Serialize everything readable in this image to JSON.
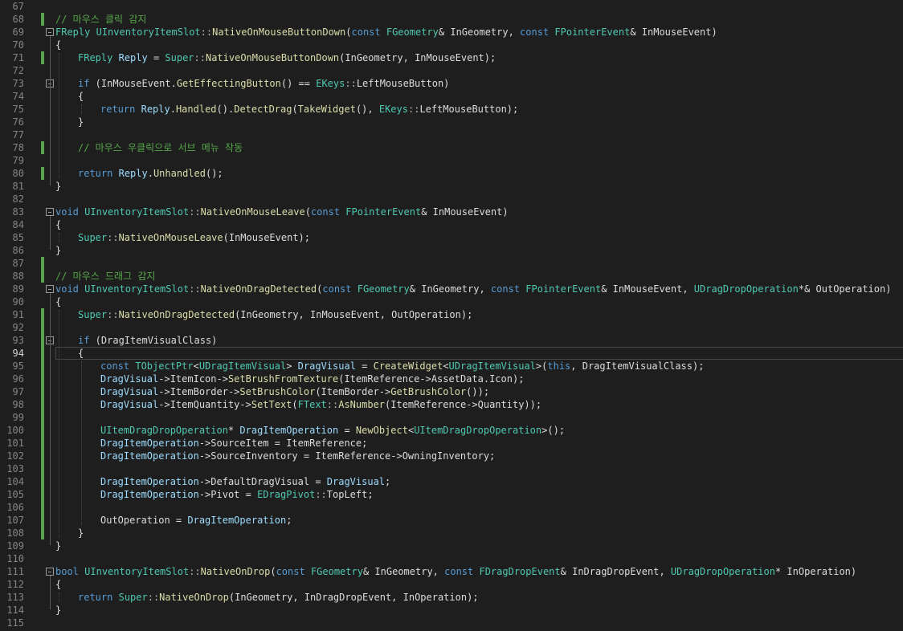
{
  "editor": {
    "first_line": 67,
    "current_line": 94,
    "lines": [
      {
        "n": "67",
        "i": 0,
        "t": []
      },
      {
        "n": "68",
        "i": 0,
        "chg": true,
        "t": [
          [
            "cm",
            "// 마우스 클릭 감지"
          ]
        ]
      },
      {
        "n": "69",
        "i": 0,
        "fold": true,
        "t": [
          [
            "ty",
            "FReply"
          ],
          [
            "pl",
            " "
          ],
          [
            "ty",
            "UInventoryItemSlot"
          ],
          [
            "op",
            "::"
          ],
          [
            "fn",
            "NativeOnMouseButtonDown"
          ],
          [
            "pl",
            "("
          ],
          [
            "kw",
            "const"
          ],
          [
            "pl",
            " "
          ],
          [
            "ty",
            "FGeometry"
          ],
          [
            "pl",
            "& InGeometry, "
          ],
          [
            "kw",
            "const"
          ],
          [
            "pl",
            " "
          ],
          [
            "ty",
            "FPointerEvent"
          ],
          [
            "pl",
            "& InMouseEvent)"
          ]
        ]
      },
      {
        "n": "70",
        "i": 0,
        "t": [
          [
            "pl",
            "{"
          ]
        ]
      },
      {
        "n": "71",
        "i": 1,
        "chg": true,
        "t": [
          [
            "ty",
            "FReply"
          ],
          [
            "pl",
            " "
          ],
          [
            "var",
            "Reply"
          ],
          [
            "pl",
            " = "
          ],
          [
            "ty",
            "Super"
          ],
          [
            "op",
            "::"
          ],
          [
            "fn",
            "NativeOnMouseButtonDown"
          ],
          [
            "pl",
            "(InGeometry, InMouseEvent);"
          ]
        ]
      },
      {
        "n": "72",
        "i": 1,
        "t": []
      },
      {
        "n": "73",
        "i": 1,
        "fold": true,
        "t": [
          [
            "kw",
            "if"
          ],
          [
            "pl",
            " (InMouseEvent."
          ],
          [
            "fn",
            "GetEffectingButton"
          ],
          [
            "pl",
            "() == "
          ],
          [
            "ty",
            "EKeys"
          ],
          [
            "op",
            "::"
          ],
          [
            "pl",
            "LeftMouseButton)"
          ]
        ]
      },
      {
        "n": "74",
        "i": 1,
        "t": [
          [
            "pl",
            "{"
          ]
        ]
      },
      {
        "n": "75",
        "i": 2,
        "t": [
          [
            "kw",
            "return"
          ],
          [
            "pl",
            " "
          ],
          [
            "var",
            "Reply"
          ],
          [
            "pl",
            "."
          ],
          [
            "fn",
            "Handled"
          ],
          [
            "pl",
            "()."
          ],
          [
            "fn",
            "DetectDrag"
          ],
          [
            "pl",
            "("
          ],
          [
            "fn",
            "TakeWidget"
          ],
          [
            "pl",
            "(), "
          ],
          [
            "ty",
            "EKeys"
          ],
          [
            "op",
            "::"
          ],
          [
            "pl",
            "LeftMouseButton);"
          ]
        ]
      },
      {
        "n": "76",
        "i": 1,
        "t": [
          [
            "pl",
            "}"
          ]
        ]
      },
      {
        "n": "77",
        "i": 1,
        "t": []
      },
      {
        "n": "78",
        "i": 1,
        "chg": true,
        "t": [
          [
            "cm",
            "// 마우스 우클릭으로 서브 메뉴 작동"
          ]
        ]
      },
      {
        "n": "79",
        "i": 1,
        "t": []
      },
      {
        "n": "80",
        "i": 1,
        "chg": true,
        "t": [
          [
            "kw",
            "return"
          ],
          [
            "pl",
            " "
          ],
          [
            "var",
            "Reply"
          ],
          [
            "pl",
            "."
          ],
          [
            "fn",
            "Unhandled"
          ],
          [
            "pl",
            "();"
          ]
        ]
      },
      {
        "n": "81",
        "i": 0,
        "t": [
          [
            "pl",
            "}"
          ]
        ]
      },
      {
        "n": "82",
        "i": 0,
        "t": []
      },
      {
        "n": "83",
        "i": 0,
        "fold": true,
        "t": [
          [
            "kw",
            "void"
          ],
          [
            "pl",
            " "
          ],
          [
            "ty",
            "UInventoryItemSlot"
          ],
          [
            "op",
            "::"
          ],
          [
            "fn",
            "NativeOnMouseLeave"
          ],
          [
            "pl",
            "("
          ],
          [
            "kw",
            "const"
          ],
          [
            "pl",
            " "
          ],
          [
            "ty",
            "FPointerEvent"
          ],
          [
            "pl",
            "& InMouseEvent)"
          ]
        ]
      },
      {
        "n": "84",
        "i": 0,
        "t": [
          [
            "pl",
            "{"
          ]
        ]
      },
      {
        "n": "85",
        "i": 1,
        "t": [
          [
            "ty",
            "Super"
          ],
          [
            "op",
            "::"
          ],
          [
            "fn",
            "NativeOnMouseLeave"
          ],
          [
            "pl",
            "(InMouseEvent);"
          ]
        ]
      },
      {
        "n": "86",
        "i": 0,
        "t": [
          [
            "pl",
            "}"
          ]
        ]
      },
      {
        "n": "87",
        "i": 0,
        "chg": true,
        "t": []
      },
      {
        "n": "88",
        "i": 0,
        "chg": true,
        "t": [
          [
            "cm",
            "// 마우스 드래그 감지"
          ]
        ]
      },
      {
        "n": "89",
        "i": 0,
        "fold": true,
        "t": [
          [
            "kw",
            "void"
          ],
          [
            "pl",
            " "
          ],
          [
            "ty",
            "UInventoryItemSlot"
          ],
          [
            "op",
            "::"
          ],
          [
            "fn",
            "NativeOnDragDetected"
          ],
          [
            "pl",
            "("
          ],
          [
            "kw",
            "const"
          ],
          [
            "pl",
            " "
          ],
          [
            "ty",
            "FGeometry"
          ],
          [
            "pl",
            "& InGeometry, "
          ],
          [
            "kw",
            "const"
          ],
          [
            "pl",
            " "
          ],
          [
            "ty",
            "FPointerEvent"
          ],
          [
            "pl",
            "& InMouseEvent, "
          ],
          [
            "ty",
            "UDragDropOperation"
          ],
          [
            "pl",
            "*& OutOperation)"
          ]
        ]
      },
      {
        "n": "90",
        "i": 0,
        "t": [
          [
            "pl",
            "{"
          ]
        ]
      },
      {
        "n": "91",
        "i": 1,
        "chg": true,
        "t": [
          [
            "ty",
            "Super"
          ],
          [
            "op",
            "::"
          ],
          [
            "fn",
            "NativeOnDragDetected"
          ],
          [
            "pl",
            "(InGeometry, InMouseEvent, OutOperation);"
          ]
        ]
      },
      {
        "n": "92",
        "i": 1,
        "chg": true,
        "t": []
      },
      {
        "n": "93",
        "i": 1,
        "chg": true,
        "fold": true,
        "t": [
          [
            "kw",
            "if"
          ],
          [
            "pl",
            " (DragItemVisualClass)"
          ]
        ]
      },
      {
        "n": "94",
        "i": 1,
        "chg": true,
        "cur": true,
        "t": [
          [
            "pl",
            "{"
          ]
        ]
      },
      {
        "n": "95",
        "i": 2,
        "chg": true,
        "t": [
          [
            "kw",
            "const"
          ],
          [
            "pl",
            " "
          ],
          [
            "ty",
            "TObjectPtr"
          ],
          [
            "pl",
            "<"
          ],
          [
            "ty",
            "UDragItemVisual"
          ],
          [
            "pl",
            "> "
          ],
          [
            "var",
            "DragVisual"
          ],
          [
            "pl",
            " = "
          ],
          [
            "fn",
            "CreateWidget"
          ],
          [
            "pl",
            "<"
          ],
          [
            "ty",
            "UDragItemVisual"
          ],
          [
            "pl",
            ">("
          ],
          [
            "kw",
            "this"
          ],
          [
            "pl",
            ", DragItemVisualClass);"
          ]
        ]
      },
      {
        "n": "96",
        "i": 2,
        "chg": true,
        "t": [
          [
            "var",
            "DragVisual"
          ],
          [
            "pl",
            "->ItemIcon->"
          ],
          [
            "fn",
            "SetBrushFromTexture"
          ],
          [
            "pl",
            "(ItemReference->AssetData.Icon);"
          ]
        ]
      },
      {
        "n": "97",
        "i": 2,
        "chg": true,
        "t": [
          [
            "var",
            "DragVisual"
          ],
          [
            "pl",
            "->ItemBorder->"
          ],
          [
            "fn",
            "SetBrushColor"
          ],
          [
            "pl",
            "(ItemBorder->"
          ],
          [
            "fn",
            "GetBrushColor"
          ],
          [
            "pl",
            "());"
          ]
        ]
      },
      {
        "n": "98",
        "i": 2,
        "chg": true,
        "t": [
          [
            "var",
            "DragVisual"
          ],
          [
            "pl",
            "->ItemQuantity->"
          ],
          [
            "fn",
            "SetText"
          ],
          [
            "pl",
            "("
          ],
          [
            "ty",
            "FText"
          ],
          [
            "op",
            "::"
          ],
          [
            "fn",
            "AsNumber"
          ],
          [
            "pl",
            "(ItemReference->Quantity));"
          ]
        ]
      },
      {
        "n": "99",
        "i": 2,
        "chg": true,
        "t": []
      },
      {
        "n": "100",
        "i": 2,
        "chg": true,
        "t": [
          [
            "ty",
            "UItemDragDropOperation"
          ],
          [
            "pl",
            "* "
          ],
          [
            "var",
            "DragItemOperation"
          ],
          [
            "pl",
            " = "
          ],
          [
            "fn",
            "NewObject"
          ],
          [
            "pl",
            "<"
          ],
          [
            "ty",
            "UItemDragDropOperation"
          ],
          [
            "pl",
            ">();"
          ]
        ]
      },
      {
        "n": "101",
        "i": 2,
        "chg": true,
        "t": [
          [
            "var",
            "DragItemOperation"
          ],
          [
            "pl",
            "->SourceItem = ItemReference;"
          ]
        ]
      },
      {
        "n": "102",
        "i": 2,
        "chg": true,
        "t": [
          [
            "var",
            "DragItemOperation"
          ],
          [
            "pl",
            "->SourceInventory = ItemReference->OwningInventory;"
          ]
        ]
      },
      {
        "n": "103",
        "i": 2,
        "chg": true,
        "t": []
      },
      {
        "n": "104",
        "i": 2,
        "chg": true,
        "t": [
          [
            "var",
            "DragItemOperation"
          ],
          [
            "pl",
            "->DefaultDragVisual = "
          ],
          [
            "var",
            "DragVisual"
          ],
          [
            "pl",
            ";"
          ]
        ]
      },
      {
        "n": "105",
        "i": 2,
        "chg": true,
        "t": [
          [
            "var",
            "DragItemOperation"
          ],
          [
            "pl",
            "->Pivot = "
          ],
          [
            "ty",
            "EDragPivot"
          ],
          [
            "op",
            "::"
          ],
          [
            "pl",
            "TopLeft;"
          ]
        ]
      },
      {
        "n": "106",
        "i": 2,
        "chg": true,
        "t": []
      },
      {
        "n": "107",
        "i": 2,
        "chg": true,
        "t": [
          [
            "pl",
            "OutOperation = "
          ],
          [
            "var",
            "DragItemOperation"
          ],
          [
            "pl",
            ";"
          ]
        ]
      },
      {
        "n": "108",
        "i": 1,
        "chg": true,
        "t": [
          [
            "pl",
            "}"
          ]
        ]
      },
      {
        "n": "109",
        "i": 0,
        "t": [
          [
            "pl",
            "}"
          ]
        ]
      },
      {
        "n": "110",
        "i": 0,
        "t": []
      },
      {
        "n": "111",
        "i": 0,
        "fold": true,
        "t": [
          [
            "kw",
            "bool"
          ],
          [
            "pl",
            " "
          ],
          [
            "ty",
            "UInventoryItemSlot"
          ],
          [
            "op",
            "::"
          ],
          [
            "fn",
            "NativeOnDrop"
          ],
          [
            "pl",
            "("
          ],
          [
            "kw",
            "const"
          ],
          [
            "pl",
            " "
          ],
          [
            "ty",
            "FGeometry"
          ],
          [
            "pl",
            "& InGeometry, "
          ],
          [
            "kw",
            "const"
          ],
          [
            "pl",
            " "
          ],
          [
            "ty",
            "FDragDropEvent"
          ],
          [
            "pl",
            "& InDragDropEvent, "
          ],
          [
            "ty",
            "UDragDropOperation"
          ],
          [
            "pl",
            "* InOperation)"
          ]
        ]
      },
      {
        "n": "112",
        "i": 0,
        "t": [
          [
            "pl",
            "{"
          ]
        ]
      },
      {
        "n": "113",
        "i": 1,
        "t": [
          [
            "kw",
            "return"
          ],
          [
            "pl",
            " "
          ],
          [
            "ty",
            "Super"
          ],
          [
            "op",
            "::"
          ],
          [
            "fn",
            "NativeOnDrop"
          ],
          [
            "pl",
            "(InGeometry, InDragDropEvent, InOperation);"
          ]
        ]
      },
      {
        "n": "114",
        "i": 0,
        "t": [
          [
            "pl",
            "}"
          ]
        ]
      },
      {
        "n": "115",
        "i": 0,
        "t": []
      }
    ]
  }
}
